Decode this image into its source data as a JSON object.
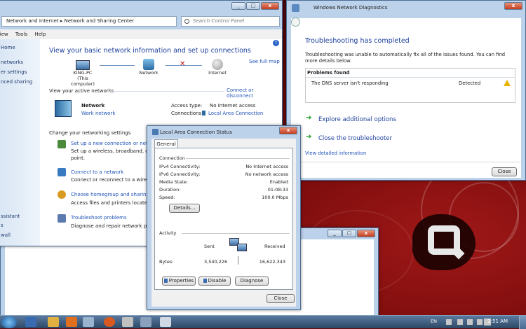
{
  "control_panel": {
    "address": "Network and Internet  ▸  Network and Sharing Center",
    "search_placeholder": "Search Control Panel",
    "menu": [
      "View",
      "Tools",
      "Help"
    ],
    "sidebar": [
      "Home",
      "networks",
      "er settings",
      "nced sharing",
      "ssistant",
      "s",
      "wall"
    ],
    "heading": "View your basic network information and set up connections",
    "see_full_map": "See full map",
    "map": {
      "computer": "KING-PC",
      "computer_sub": "(This computer)",
      "network": "Network",
      "internet": "Internet"
    },
    "active_networks_label": "View your active networks",
    "connect_disconnect": "Connect or disconnect",
    "network_name": "Network",
    "network_type": "Work network",
    "access_type_label": "Access type:",
    "access_type_value": "No Internet access",
    "connections_label": "Connections:",
    "connections_value": "Local Area Connection",
    "change_settings_label": "Change your networking settings",
    "tasks": [
      {
        "link": "Set up a new connection or network",
        "desc": "Set up a wireless, broadband, dial-",
        "desc2": "point."
      },
      {
        "link": "Connect to a network",
        "desc": "Connect or reconnect to a wireless"
      },
      {
        "link": "Choose homegroup and sharing o",
        "desc": "Access files and printers located on"
      },
      {
        "link": "Troubleshoot problems",
        "desc": "Diagnose and repair network problem"
      }
    ]
  },
  "diagnostics": {
    "title": "Windows Network Diagnostics",
    "heading": "Troubleshooting has completed",
    "message": "Troubleshooting was unable to automatically fix all of the issues found. You can find more details below.",
    "problems_header": "Problems found",
    "problem": "The DNS server isn't responding",
    "problem_status": "Detected",
    "explore": "Explore additional options",
    "close_troubleshooter": "Close the troubleshooter",
    "view_detail": "View detailed information",
    "close_button": "Close"
  },
  "lac_status": {
    "title": "Local Area Connection Status",
    "tab": "General",
    "connection_label": "Connection",
    "rows": [
      {
        "label": "IPv4 Connectivity:",
        "value": "No Internet access"
      },
      {
        "label": "IPv6 Connectivity:",
        "value": "No network access"
      },
      {
        "label": "Media State:",
        "value": "Enabled"
      },
      {
        "label": "Duration:",
        "value": "01:08:33"
      },
      {
        "label": "Speed:",
        "value": "100.0 Mbps"
      }
    ],
    "details_button": "Details...",
    "activity_label": "Activity",
    "sent_label": "Sent",
    "received_label": "Received",
    "bytes_label": "Bytes:",
    "bytes_sent": "3,540,226",
    "bytes_received": "16,622,343",
    "properties_button": "Properties",
    "disable_button": "Disable",
    "diagnose_button": "Diagnose",
    "close_button": "Close"
  },
  "taskbar": {
    "language": "EN",
    "clock": "2:51 AM"
  }
}
